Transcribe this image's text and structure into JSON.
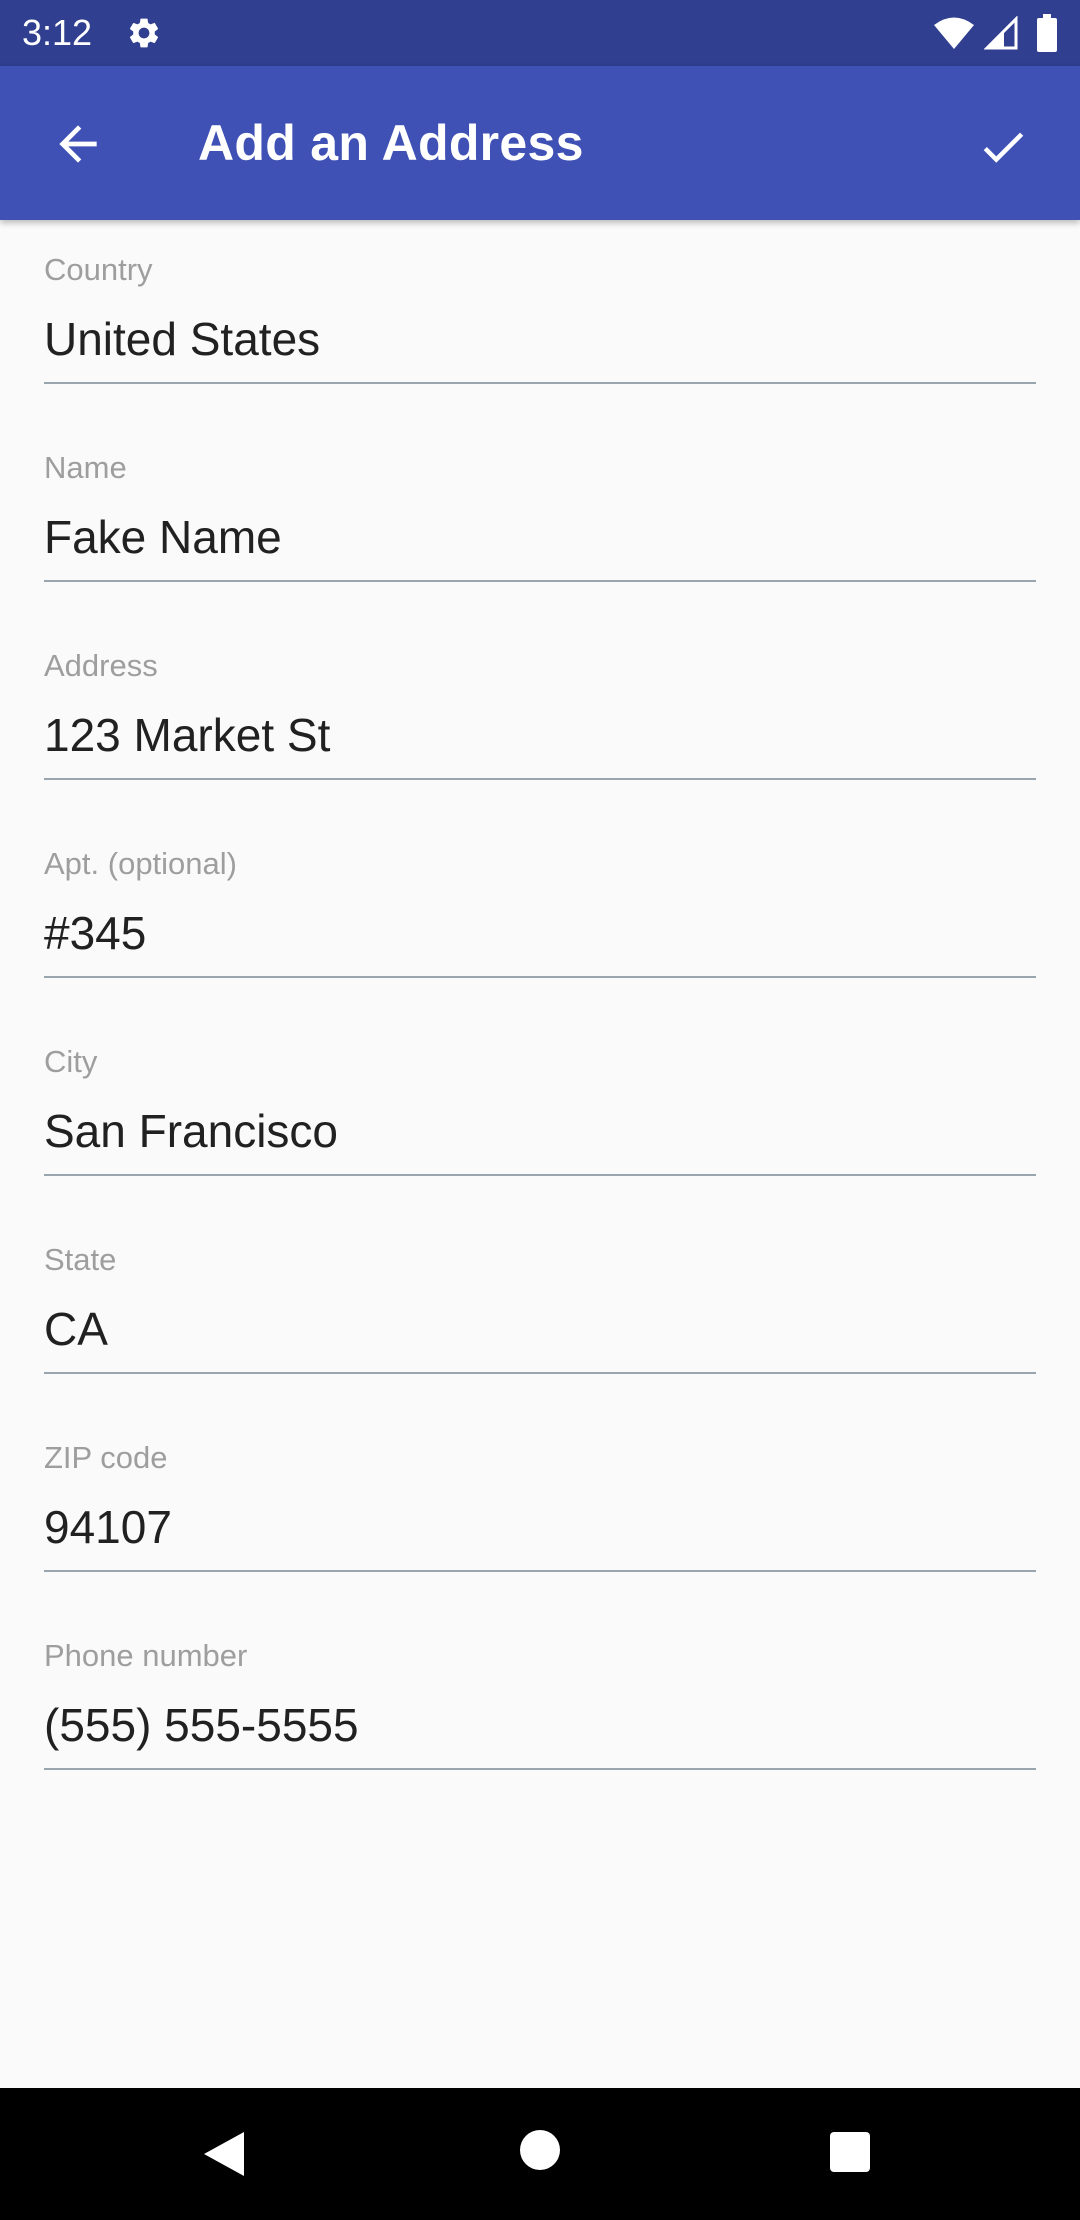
{
  "status_bar": {
    "time": "3:12",
    "icons": [
      "gear-icon",
      "wifi-icon",
      "signal-icon",
      "battery-icon"
    ]
  },
  "app_bar": {
    "title": "Add an Address",
    "back_icon": "arrow-back-icon",
    "confirm_icon": "check-icon",
    "background_color": "#3f51b5",
    "status_color": "#303f8f"
  },
  "form": {
    "fields": [
      {
        "label": "Country",
        "value": "United States"
      },
      {
        "label": "Name",
        "value": "Fake Name"
      },
      {
        "label": "Address",
        "value": "123 Market St"
      },
      {
        "label": "Apt. (optional)",
        "value": "#345"
      },
      {
        "label": "City",
        "value": "San Francisco"
      },
      {
        "label": "State",
        "value": "CA"
      },
      {
        "label": "ZIP code",
        "value": "94107"
      },
      {
        "label": "Phone number",
        "value": "(555) 555-5555"
      }
    ]
  },
  "nav_bar": {
    "icons": [
      "nav-back-icon",
      "nav-home-icon",
      "nav-recents-icon"
    ]
  }
}
